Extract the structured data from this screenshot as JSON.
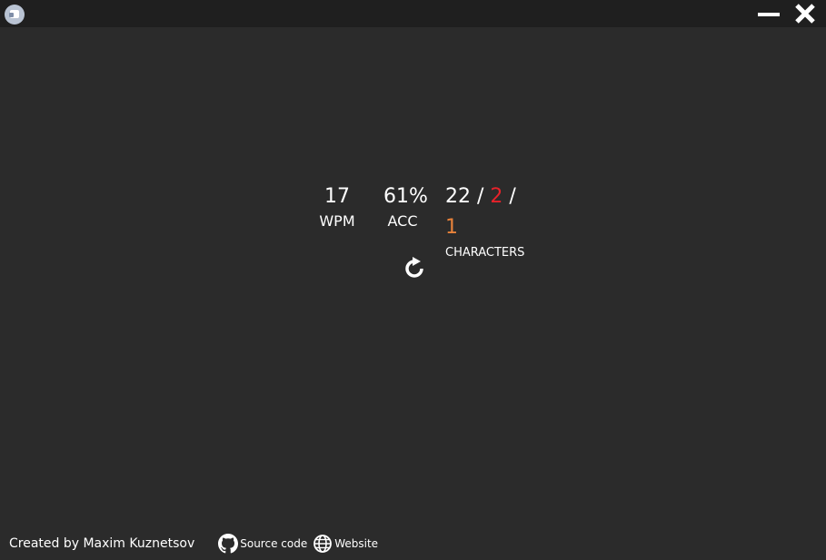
{
  "titlebar": {
    "icons": [
      "app-icon",
      "minimize-icon",
      "close-icon"
    ]
  },
  "stats": {
    "wpm": {
      "value": "17",
      "label": "WPM"
    },
    "accuracy": {
      "value": "61%",
      "label": "ACC"
    },
    "characters": {
      "correct": "22",
      "incorrect": "2",
      "extra": "1",
      "separator": "/",
      "label": "CHARACTERS"
    }
  },
  "restart": {
    "icon": "restart-icon"
  },
  "footer": {
    "credit": "Created by Maxim Kuznetsov",
    "source_label": "Source code",
    "website_label": "Website"
  },
  "colors": {
    "background": "#2b2b2b",
    "titlebar": "#1f1f1f",
    "text": "#ffffff",
    "incorrect": "#e8222a",
    "extra": "#e8823a"
  }
}
